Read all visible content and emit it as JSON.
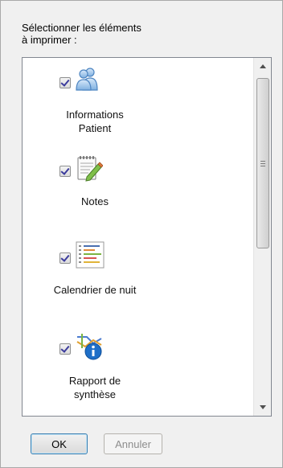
{
  "dialog": {
    "prompt": "Sélectionner les éléments\nà imprimer :"
  },
  "items": [
    {
      "label": "Informations\nPatient",
      "checked": true,
      "icon": "patient-icon"
    },
    {
      "label": "Notes",
      "checked": true,
      "icon": "notes-icon"
    },
    {
      "label": "Calendrier de nuit",
      "checked": true,
      "icon": "calendar-list-icon"
    },
    {
      "label": "Rapport de\nsynthèse",
      "checked": true,
      "icon": "report-icon"
    }
  ],
  "scrollbar": {
    "position": 0.0
  },
  "buttons": {
    "ok": "OK",
    "cancel": "Annuler"
  },
  "colors": {
    "dialog_bg": "#f0f0f0",
    "list_bg": "#ffffff",
    "check_mark": "#3b3b9c",
    "disabled_text": "#8d8d8d",
    "ok_border": "#3c7fb1"
  }
}
